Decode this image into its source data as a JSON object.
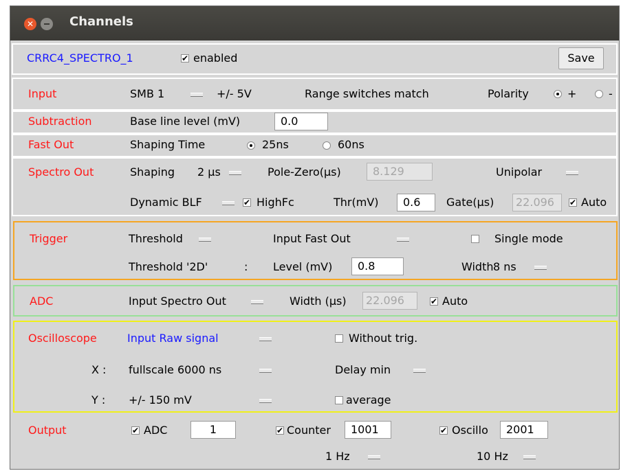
{
  "window": {
    "title": "Channels"
  },
  "header": {
    "channel_name": "CRRC4_SPECTRO_1",
    "enabled_label": "enabled",
    "enabled": true,
    "save_label": "Save"
  },
  "input": {
    "section": "Input",
    "connector": "SMB 1",
    "range": "+/- 5V",
    "range_match": "Range switches match",
    "polarity_label": "Polarity",
    "pol_plus": "+",
    "pol_minus": "-",
    "polarity_selected": "+"
  },
  "subtraction": {
    "section": "Subtraction",
    "baseline_label": "Base line level (mV)",
    "baseline_value": "0.0"
  },
  "fast_out": {
    "section": "Fast Out",
    "shaping_label": "Shaping Time",
    "opt1": "25ns",
    "opt2": "60ns",
    "selected": "25ns"
  },
  "spectro_out": {
    "section": "Spectro Out",
    "shaping_label": "Shaping",
    "shaping_value": "2 µs",
    "polezero_label": "Pole-Zero(µs)",
    "polezero_value": "8.129",
    "unipolar_label": "Unipolar",
    "dynamic_label": "Dynamic BLF",
    "highfc_label": "HighFc",
    "highfc": true,
    "thr_label": "Thr(mV)",
    "thr_value": "0.6",
    "gate_label": "Gate(µs)",
    "gate_value": "22.096",
    "auto_label": "Auto",
    "auto": true
  },
  "trigger": {
    "section": "Trigger",
    "mode": "Threshold",
    "input_label": "Input Fast Out",
    "single_label": "Single mode",
    "single": false,
    "threshold2d": "Threshold '2D'",
    "colon": ":",
    "level_label": "Level (mV)",
    "level_value": "0.8",
    "width_label": "Width",
    "width_value": "8 ns"
  },
  "adc": {
    "section": "ADC",
    "input_label": "Input Spectro Out",
    "width_label": "Width (µs)",
    "width_value": "22.096",
    "auto_label": "Auto",
    "auto": true
  },
  "oscilloscope": {
    "section": "Oscilloscope",
    "input_label": "Input Raw signal",
    "without_trig_label": "Without trig.",
    "without_trig": false,
    "x_label": "X :",
    "x_value": "fullscale 6000 ns",
    "delay_label": "Delay min",
    "y_label": "Y :",
    "y_value": "+/-  150 mV",
    "average_label": "average",
    "average": false
  },
  "output": {
    "section": "Output",
    "adc_label": "ADC",
    "adc": true,
    "adc_value": "1",
    "counter_label": "Counter",
    "counter": true,
    "counter_value": "1001",
    "oscillo_label": "Oscillo",
    "oscillo": true,
    "oscillo_value": "2001",
    "rate1": "1 Hz",
    "rate2": "10 Hz"
  },
  "colors": {
    "section_red": "#ff1a1a",
    "link_blue": "#1a1aff",
    "trigger_border": "#f5a623",
    "adc_border": "#98e098",
    "osc_border": "#f0f01a"
  }
}
